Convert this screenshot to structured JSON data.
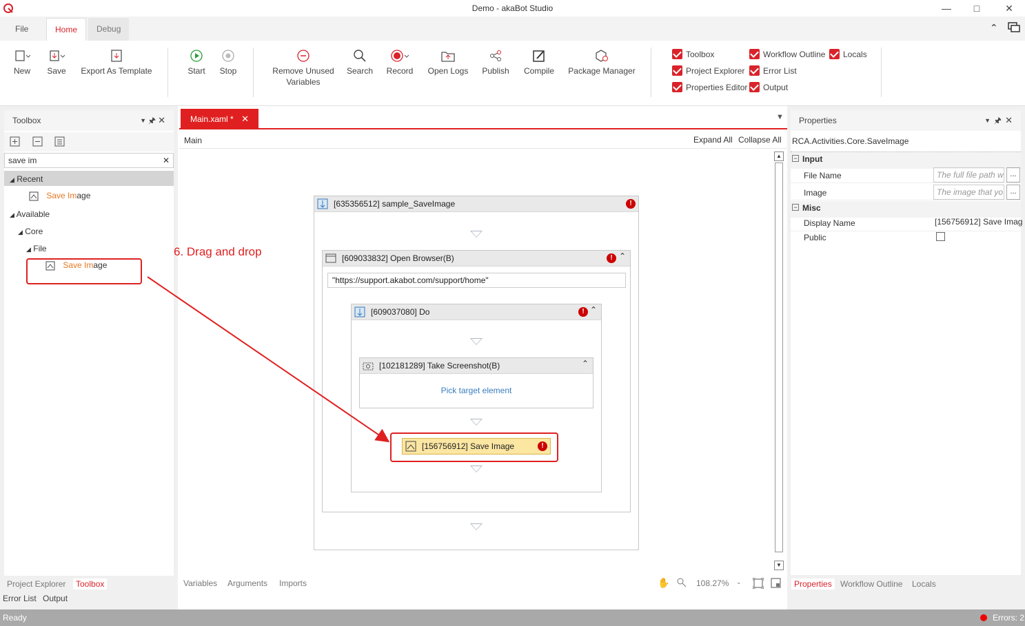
{
  "window": {
    "title": "Demo - akaBot Studio"
  },
  "ribbon_tabs": [
    "File",
    "Home",
    "Debug"
  ],
  "ribbon": {
    "new": "New",
    "save": "Save",
    "export": "Export As Template",
    "start": "Start",
    "stop": "Stop",
    "remove_unused": "Remove Unused",
    "variables": "Variables",
    "search": "Search",
    "record": "Record",
    "open_logs": "Open Logs",
    "publish": "Publish",
    "compile": "Compile",
    "package_manager": "Package Manager",
    "checks": {
      "toolbox": "Toolbox",
      "project_explorer": "Project Explorer",
      "properties_editor": "Properties Editor",
      "workflow_outline": "Workflow Outline",
      "error_list": "Error List",
      "output": "Output",
      "locals": "Locals"
    }
  },
  "toolbox": {
    "title": "Toolbox",
    "search_value": "save im",
    "recent": "Recent",
    "recent_item": {
      "match": "Save Im",
      "rest": "age"
    },
    "available": "Available",
    "core": "Core",
    "file": "File",
    "file_item": {
      "match": "Save Im",
      "rest": "age"
    }
  },
  "annotation": {
    "label": "6. Drag and drop",
    "color": "#e02020"
  },
  "doc_tab": {
    "label": "Main.xaml *"
  },
  "designer": {
    "breadcrumb": "Main",
    "expand_all": "Expand All",
    "collapse_all": "Collapse All",
    "seq_title": "[635356512] sample_SaveImage",
    "browser_title": "[609033832] Open Browser(B)",
    "browser_url": "\"https://support.akabot.com/support/home\"",
    "do_title": "[609037080] Do",
    "screenshot_title": "[102181289] Take Screenshot(B)",
    "pick_target": "Pick target element",
    "save_image_title": "[156756912] Save Image",
    "bottom_tabs": [
      "Variables",
      "Arguments",
      "Imports"
    ],
    "zoom": "108.27%"
  },
  "properties": {
    "title": "Properties",
    "type": "RCA.Activities.Core.SaveImage",
    "input": "Input",
    "misc": "Misc",
    "file_name_label": "File Name",
    "file_name_placeholder": "The full file path w",
    "image_label": "Image",
    "image_placeholder": "The image that yo",
    "display_name_label": "Display Name",
    "display_name_value": "[156756912] Save Imag",
    "public_label": "Public",
    "browse": "..."
  },
  "left_bottom_tabs": [
    "Project Explorer",
    "Toolbox"
  ],
  "left_bottom_tabs2": [
    "Error List",
    "Output"
  ],
  "right_bottom_tabs": [
    "Properties",
    "Workflow Outline",
    "Locals"
  ],
  "status": {
    "ready": "Ready",
    "errors": "Errors: 2"
  }
}
